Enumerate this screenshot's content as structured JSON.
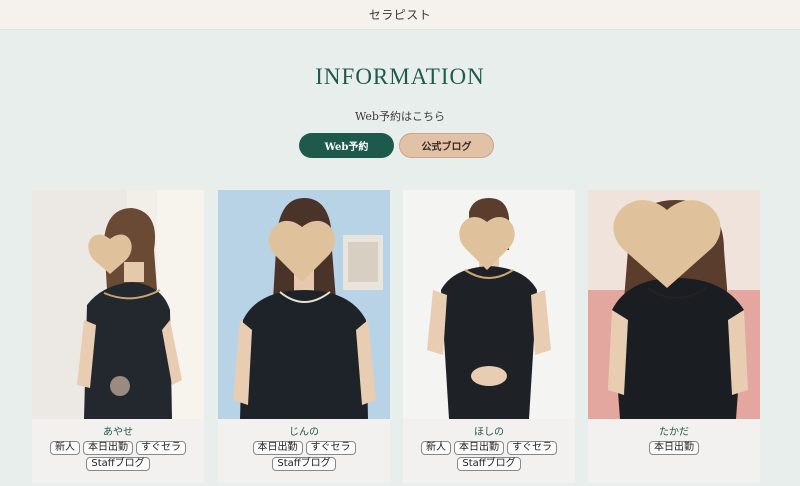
{
  "header": {
    "nav_label": "セラピスト"
  },
  "info": {
    "title": "INFORMATION",
    "subtitle": "Web予約はこちら",
    "web_button": "Web予約",
    "blog_button": "公式ブログ"
  },
  "colors": {
    "accent": "#1e5a4c",
    "secondary": "#e2c2a6",
    "background": "#e8eeec",
    "heart": "#dfc29b"
  },
  "therapists": [
    {
      "name": "あやせ",
      "tags": [
        "新人",
        "本日出勤",
        "すぐセラ",
        "Staffブログ"
      ]
    },
    {
      "name": "じんの",
      "tags": [
        "本日出勤",
        "すぐセラ",
        "Staffブログ"
      ]
    },
    {
      "name": "ほしの",
      "tags": [
        "新人",
        "本日出勤",
        "すぐセラ",
        "Staffブログ"
      ]
    },
    {
      "name": "たかだ",
      "tags": [
        "本日出勤"
      ]
    }
  ]
}
